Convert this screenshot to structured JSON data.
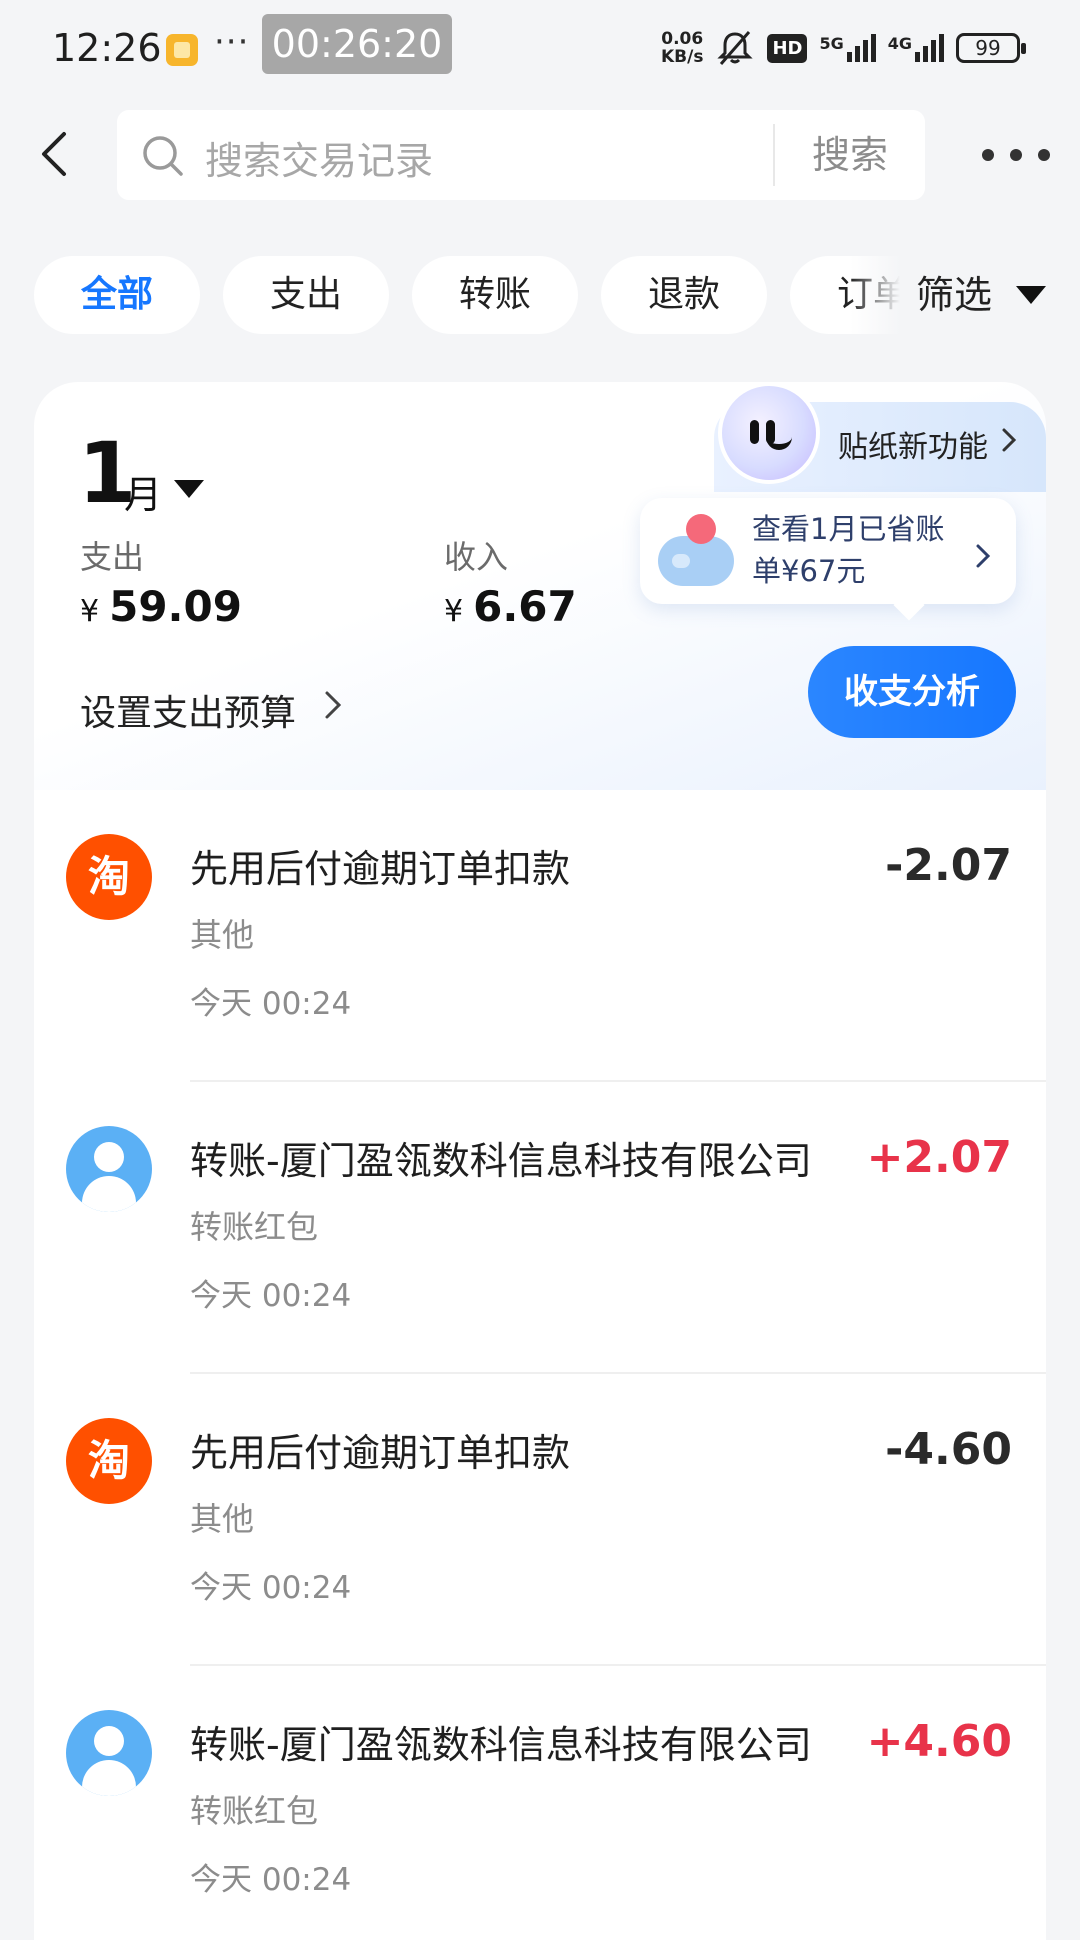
{
  "status_bar": {
    "time": "12:26",
    "dots": "···",
    "recording_timer": "00:26:20",
    "net_speed_value": "0.06",
    "net_speed_unit": "KB/s",
    "hd_badge": "HD",
    "net1": "5G",
    "net2": "4G",
    "battery": "99"
  },
  "search": {
    "placeholder": "搜索交易记录",
    "button_label": "搜索"
  },
  "filters": {
    "tabs": [
      {
        "label": "全部",
        "active": true
      },
      {
        "label": "支出",
        "active": false
      },
      {
        "label": "转账",
        "active": false
      },
      {
        "label": "退款",
        "active": false
      },
      {
        "label": "订单",
        "active": false
      }
    ],
    "filter_label": "筛选"
  },
  "summary": {
    "month_num": "1",
    "month_unit": "月",
    "expense_label": "支出",
    "expense_currency": "¥",
    "expense_value": "59.09",
    "income_label": "收入",
    "income_currency": "¥",
    "income_value": "6.67",
    "budget_label": "设置支出预算",
    "sticker_label": "贴纸新功能",
    "savings_text": "查看1月已省账单¥67元",
    "analysis_button": "收支分析"
  },
  "transactions": [
    {
      "icon": "taobao-icon",
      "icon_char": "淘",
      "title": "先用后付逾期订单扣款",
      "category": "其他",
      "time": "今天 00:24",
      "amount": "-2.07",
      "direction": "out"
    },
    {
      "icon": "person-icon",
      "title": "转账-厦门盈瓴数科信息科技有限公司",
      "category": "转账红包",
      "time": "今天 00:24",
      "amount": "+2.07",
      "direction": "in"
    },
    {
      "icon": "taobao-icon",
      "icon_char": "淘",
      "title": "先用后付逾期订单扣款",
      "category": "其他",
      "time": "今天 00:24",
      "amount": "-4.60",
      "direction": "out"
    },
    {
      "icon": "person-icon",
      "title": "转账-厦门盈瓴数科信息科技有限公司",
      "category": "转账红包",
      "time": "今天 00:24",
      "amount": "+4.60",
      "direction": "in"
    }
  ],
  "colors": {
    "accent": "#1677ff",
    "income": "#e8334a",
    "taobao": "#ff5000",
    "person": "#5bb0f5"
  }
}
